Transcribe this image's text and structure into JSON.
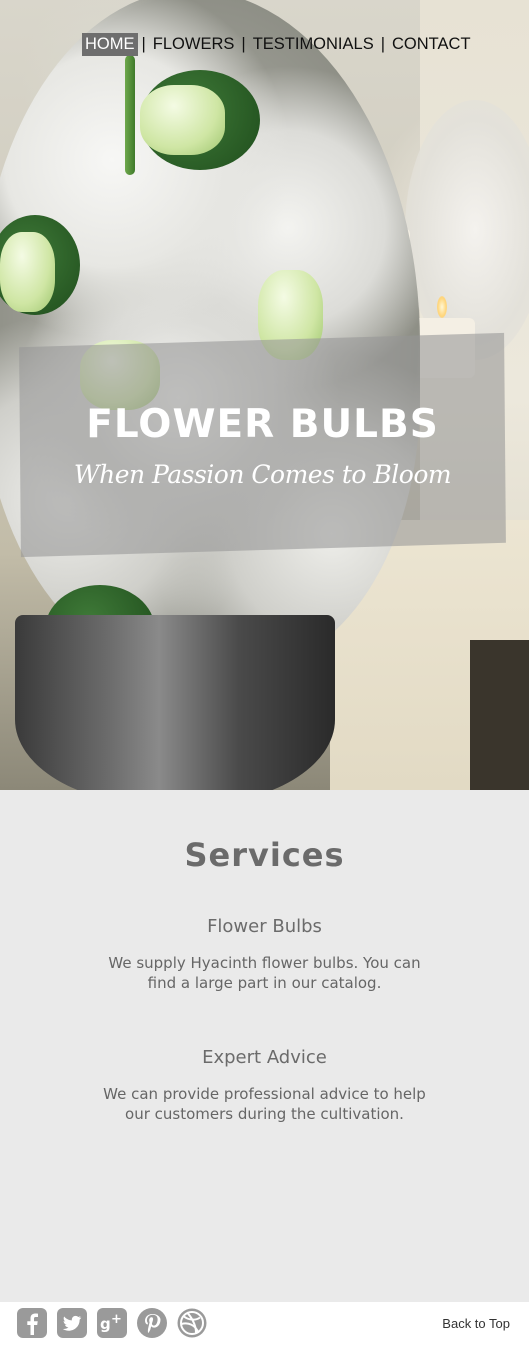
{
  "nav": {
    "items": [
      {
        "label": "HOME",
        "active": true
      },
      {
        "label": "FLOWERS"
      },
      {
        "label": "TESTIMONIALS"
      },
      {
        "label": "CONTACT"
      }
    ],
    "separator": "|"
  },
  "hero": {
    "title": "FLOWER BULBS",
    "subtitle": "When Passion Comes to Bloom"
  },
  "services": {
    "title": "Services",
    "items": [
      {
        "title": "Flower Bulbs",
        "description": "We supply Hyacinth flower bulbs. You can find a large part in our catalog."
      },
      {
        "title": "Expert Advice",
        "description": "We can provide professional advice to help our customers during the cultivation."
      }
    ]
  },
  "footer": {
    "socials": [
      "facebook-icon",
      "twitter-icon",
      "google-plus-icon",
      "pinterest-icon",
      "dribbble-icon"
    ],
    "back_to_top": "Back to Top"
  },
  "colors": {
    "nav_active_bg": "#6e6e6e",
    "services_bg": "#eaeaea",
    "icon_gray": "#9a9a9a"
  }
}
